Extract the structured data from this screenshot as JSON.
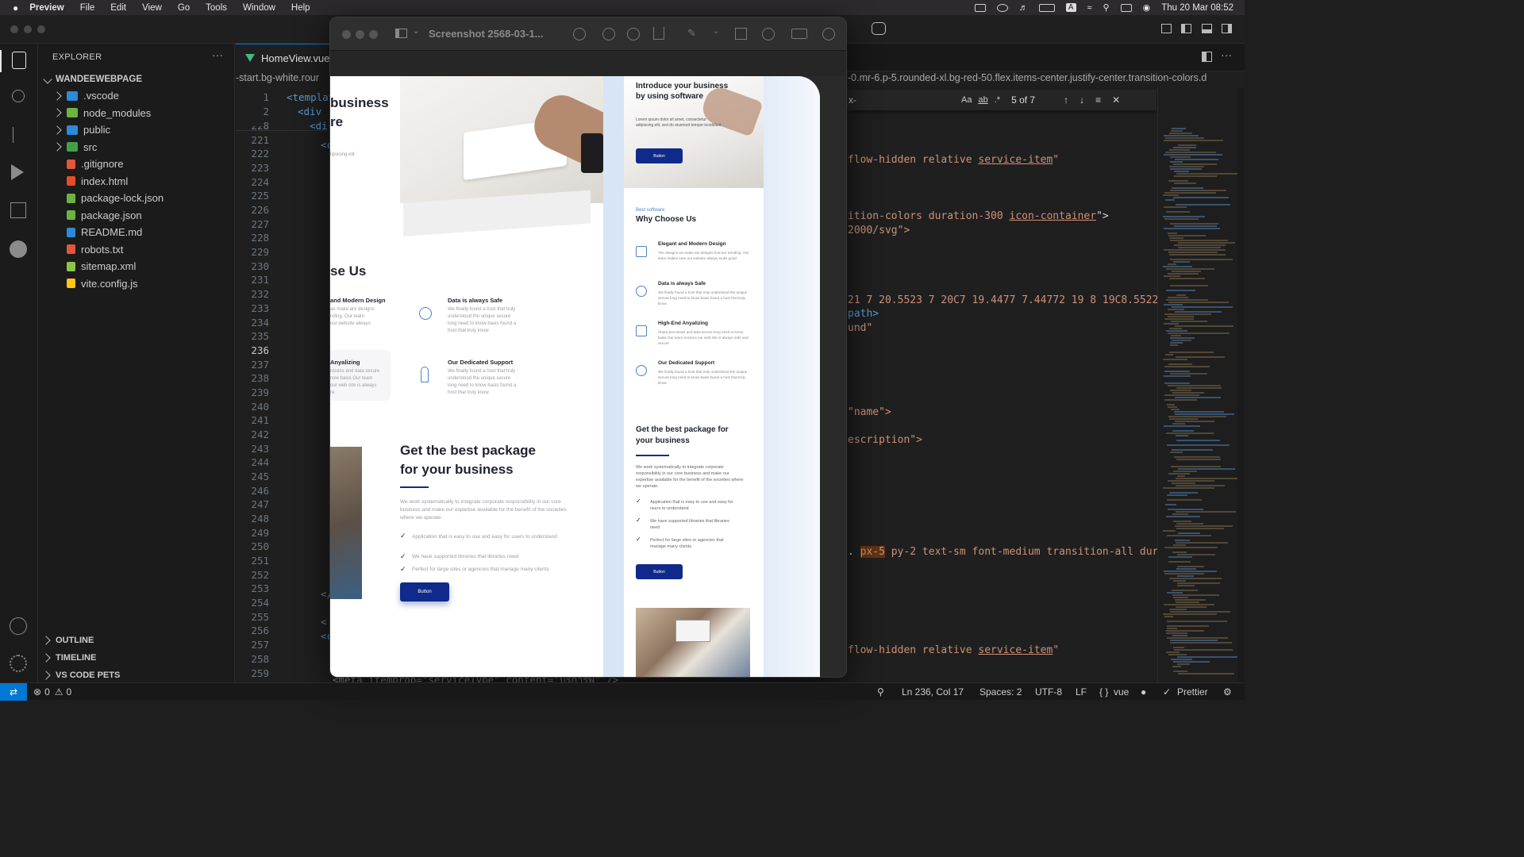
{
  "menubar": {
    "app": "Preview",
    "items": [
      "File",
      "Edit",
      "View",
      "Go",
      "Tools",
      "Window",
      "Help"
    ],
    "clock": "Thu 20 Mar  08:52"
  },
  "sidebar": {
    "title": "EXPLORER",
    "root": "WANDEEWEBPAGE",
    "items": [
      {
        "label": ".vscode",
        "type": "folder",
        "color": "#2b8ad9"
      },
      {
        "label": "node_modules",
        "type": "folder",
        "color": "#6db33f"
      },
      {
        "label": "public",
        "type": "folder",
        "color": "#2b8ad9"
      },
      {
        "label": "src",
        "type": "folder",
        "color": "#43a047"
      },
      {
        "label": ".gitignore",
        "type": "file",
        "color": "#e2563b"
      },
      {
        "label": "index.html",
        "type": "file",
        "color": "#e44d26"
      },
      {
        "label": "package-lock.json",
        "type": "file",
        "color": "#6db33f"
      },
      {
        "label": "package.json",
        "type": "file",
        "color": "#6db33f"
      },
      {
        "label": "README.md",
        "type": "file",
        "color": "#2b8ad9"
      },
      {
        "label": "robots.txt",
        "type": "file",
        "color": "#e2563b"
      },
      {
        "label": "sitemap.xml",
        "type": "file",
        "color": "#8bc34a"
      },
      {
        "label": "vite.config.js",
        "type": "file",
        "color": "#ffc517"
      }
    ],
    "sections": [
      "OUTLINE",
      "TIMELINE",
      "VS CODE PETS"
    ]
  },
  "editor": {
    "tab": "HomeView.vue",
    "breadcrumb_left": "-start.bg-white.rour",
    "breadcrumb_right": "-0.mr-6.p-5.rounded-xl.bg-red-50.flex.items-center.justify-center.transition-colors.d",
    "sticky_lines": [
      "1",
      "2",
      "8"
    ],
    "sticky_code": [
      "<templat",
      "<div",
      "<di"
    ],
    "line_numbers": [
      "220",
      "221",
      "222",
      "223",
      "224",
      "225",
      "226",
      "227",
      "228",
      "229",
      "230",
      "231",
      "232",
      "233",
      "234",
      "235",
      "236",
      "237",
      "238",
      "239",
      "240",
      "241",
      "242",
      "243",
      "244",
      "245",
      "246",
      "247",
      "248",
      "249",
      "250",
      "251",
      "252",
      "253",
      "254",
      "255",
      "256",
      "257",
      "258",
      "259"
    ],
    "current_line": "236",
    "code_fragments": {
      "l221": "<c",
      "l253": "</",
      "l255": "<",
      "l256": "<c",
      "l259": "<meta itemprop=\"serviceType\" content=\"บริการพั\" />"
    },
    "right_code": {
      "r1a": "flow-hidden relative ",
      "r1b": "service-item",
      "r1c": "\"",
      "r2a": "ition-colors duration-300 ",
      "r2b": "icon-container",
      "r2c": "\">",
      "r3": "2000/svg\">",
      "r4": " 21 7 20.5523 7 20C7 19.4477 7.44772 19 8 19C8.55228 19",
      "r5": "path>",
      "r6": "und\"",
      "r7": "\"name\">",
      "r8": "escription\">",
      "r9a": "px-5",
      "r9b": " py-2 text-sm font-medium transition-all duration-",
      "r10a": "flow-hidden relative ",
      "r10b": "service-item",
      "r10c": "\""
    },
    "find": {
      "query": "x-",
      "count": "5 of 7",
      "opt1": "Aa",
      "opt2": "ab",
      "opt3": ".*"
    }
  },
  "preview": {
    "title": "Screenshot 2568-03-1...",
    "left_page": {
      "heading_a": "business",
      "heading_b": "re",
      "tiny": "lipsicing elit.",
      "section_heading": "se Us",
      "f1_title": "and Modern Design",
      "f1_desc": "ae make are designs\nnding. Our team\nour website always",
      "f2_title": "Data is always Safe",
      "f2_desc": "We finally found a host that truly\nunderstood the unique secure\nlong need to know basis found a\nhost that truly know",
      "f3_title": "Anyalizing",
      "f3_desc": "rocess and data secure\nnow basis Our team\nour web site is always\nre",
      "f4_title": "Our Dedicated Support",
      "f4_desc": "We finally found a host that truly\nunderstood the unique secure\nlong need to know basis found a\nhost that truly know",
      "package_title_1": "Get the best package",
      "package_title_2": "for your business",
      "package_desc": "We work systematically to integrate corporate responsibility in our core business and make our expertise available for the benefit of the societies where we operate.",
      "checks": [
        "Application that is easy to use and easy for users to understand",
        "We have supported libraries that libraries need",
        "Perfect for large sites or agencies that manage many clients"
      ],
      "button": "Button"
    },
    "right_page": {
      "hero_title": "Introduce your business by using software",
      "hero_desc": "Lorem ipsum dolor sit amet, consectetur adipiscing elit, sed do eiusmod tempor incididunt",
      "button": "Button",
      "kicker": "Best software",
      "section_title": "Why Choose Us",
      "features": [
        {
          "title": "Elegant and Modern Design",
          "desc": "The designs we make are designs that are trending. Our team makes sure our website always looks good"
        },
        {
          "title": "Data is always Safe",
          "desc": "We finally found a host that truly understood the unique secure long need to know basis found a host that truly know"
        },
        {
          "title": "High-End Anyalizing",
          "desc": "Share processes and data secure long need to know basis Our team ensures our web site is always safe and secure"
        },
        {
          "title": "Our Dedicated Support",
          "desc": "We finally found a host that truly understood the unique secure long need to know basis found a host that truly know"
        }
      ],
      "package_title": "Get the best package for your business",
      "package_desc": "We work systematically to integrate corporate responsibility in our core business and make our expertise available for the benefit of the societies where we operate.",
      "checks": [
        "Application that is easy to use and easy for users to understand",
        "We have supported libraries that libraries need",
        "Perfect for large sites or agencies that manage many clients."
      ],
      "button2": "Button"
    }
  },
  "status": {
    "errors": "0",
    "warnings": "0",
    "position": "Ln 236, Col 17",
    "spaces": "Spaces: 2",
    "encoding": "UTF-8",
    "eol": "LF",
    "language": "vue",
    "formatter": "Prettier"
  }
}
